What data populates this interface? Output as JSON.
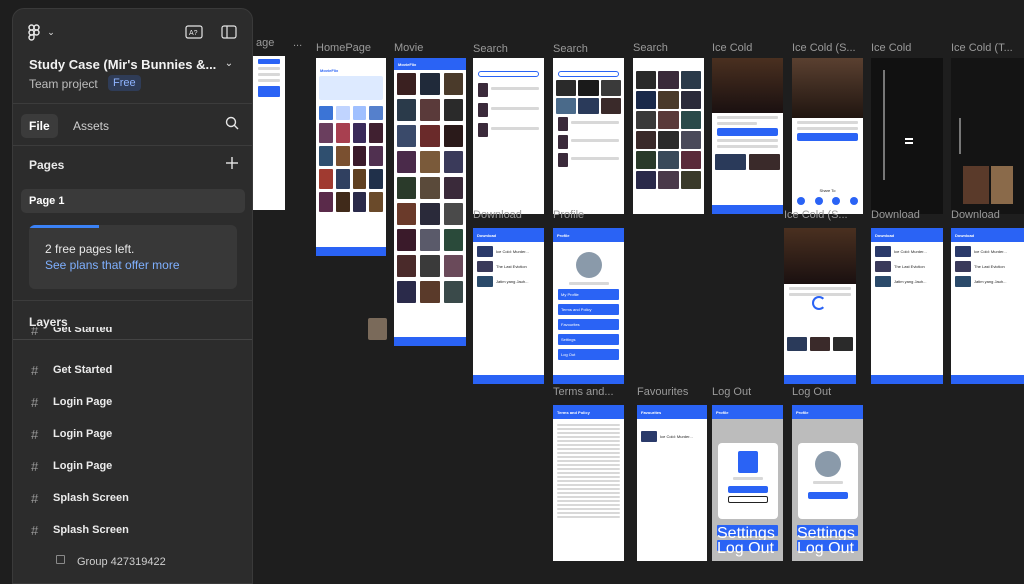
{
  "sidebar": {
    "project_title": "Study Case (Mir's Bunnies &...",
    "team_label": "Team project",
    "plan_badge": "Free",
    "tabs": {
      "file": "File",
      "assets": "Assets"
    },
    "pages_title": "Pages",
    "pages": [
      "Page 1"
    ],
    "notice": {
      "text": "2 free pages left.",
      "link": "See plans that offer more"
    },
    "layers_title": "Layers",
    "layers": [
      {
        "name": "Get Started"
      },
      {
        "name": "Get Started"
      },
      {
        "name": "Login Page"
      },
      {
        "name": "Login Page"
      },
      {
        "name": "Login Page"
      },
      {
        "name": "Splash Screen"
      },
      {
        "name": "Splash Screen"
      },
      {
        "name": "Group 427319422"
      }
    ],
    "icons": [
      "figma-logo-icon",
      "chevron-down-icon",
      "text-autocomplete-icon",
      "sidebar-toggle-icon",
      "search-icon",
      "plus-icon",
      "frame-hash-icon"
    ]
  },
  "canvas": {
    "frame_labels": [
      "age",
      "...",
      "HomePage",
      "Movie",
      "Search",
      "Search",
      "Search",
      "Ice Cold",
      "Ice Cold (S...",
      "Ice Cold",
      "Ice Cold (T...",
      "Download",
      "Profile",
      "Ice Cold (S...",
      "Download",
      "Download",
      "Terms and...",
      "Favourites",
      "Log Out",
      "Log Out"
    ],
    "frame_titles": {
      "homepage": "MovieFlix",
      "movie": "MovieFlix",
      "download": "Download",
      "profile": "Profile",
      "download2": "Download",
      "download3": "Download",
      "terms": "Terms and Policy",
      "favourites": "Favourites",
      "logout1": "Profile",
      "logout2": "Profile"
    },
    "profile_menu": [
      "My Profile",
      "Terms and Policy",
      "Favourites",
      "Settings",
      "Log Out"
    ],
    "download_items": [
      "Ice Cold: Murder...",
      "The Last Eviction",
      "Jatim yang Jauh..."
    ],
    "share_title": "Share To",
    "colors": {
      "canvas_bg": "#1e1e1e",
      "panel_bg": "#2c2c2c",
      "accent": "#2a63f5",
      "link": "#7fb0ff"
    }
  }
}
